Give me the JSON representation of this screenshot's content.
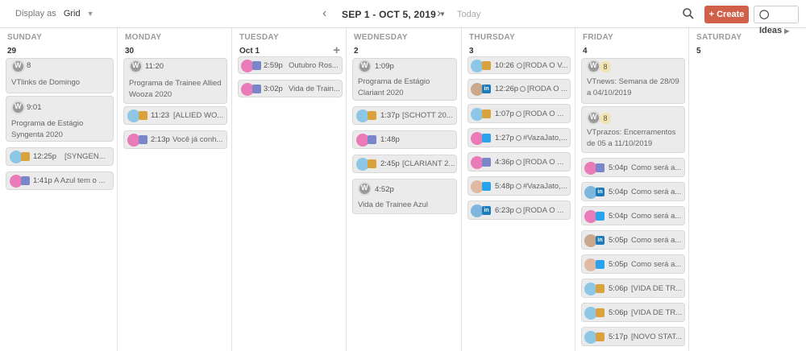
{
  "toolbar": {
    "display_label": "Display as",
    "display_value": "Grid",
    "date_range": "SEP 1 - OCT 5, 2019",
    "today_label": "Today",
    "create_label": "Create",
    "ideas_label": "Ideas"
  },
  "days": [
    {
      "name": "SUNDAY",
      "num": "29"
    },
    {
      "name": "MONDAY",
      "num": "30"
    },
    {
      "name": "TUESDAY",
      "num": "Oct 1"
    },
    {
      "name": "WEDNESDAY",
      "num": "2"
    },
    {
      "name": "THURSDAY",
      "num": "3"
    },
    {
      "name": "FRIDAY",
      "num": "4"
    },
    {
      "name": "SATURDAY",
      "num": "5"
    }
  ],
  "sunday": {
    "c1": {
      "badge": "8",
      "text": "VTlinks de Domingo"
    },
    "c2": {
      "time": "9:01",
      "text": "Programa de Estágio Syngenta 2020"
    },
    "c3": {
      "time": "12:25p",
      "text": "[SYNGEN..."
    },
    "c4": {
      "time": "1:41p",
      "text": "A Azul tem o ..."
    }
  },
  "monday": {
    "c1": {
      "time": "11:20",
      "text": "Programa de Trainee Allied Wooza 2020"
    },
    "c2": {
      "time": "11:23",
      "text": "[ALLIED WO..."
    },
    "c3": {
      "time": "2:13p",
      "text": "Você já conh..."
    }
  },
  "tuesday": {
    "c1": {
      "time": "2:59p",
      "text": "Outubro Ros..."
    },
    "c2": {
      "time": "3:02p",
      "text": "Vida de Train..."
    }
  },
  "wednesday": {
    "c1": {
      "time": "1:09p",
      "text": "Programa de Estágio Clariant 2020"
    },
    "c2": {
      "time": "1:37p",
      "text": "[SCHOTT 20..."
    },
    "c3": {
      "time": "1:48p",
      "text": ""
    },
    "c4": {
      "time": "2:45p",
      "text": "[CLARIANT 2..."
    },
    "c5": {
      "time": "4:52p",
      "text": "Vida de Trainee Azul"
    }
  },
  "thursday": {
    "c1": {
      "time": "10:26",
      "text": "[RODA O V..."
    },
    "c2": {
      "time": "12:26p",
      "text": "[RODA O ..."
    },
    "c3": {
      "time": "1:07p",
      "text": "[RODA O ..."
    },
    "c4": {
      "time": "1:27p",
      "text": "#VazaJato,..."
    },
    "c5": {
      "time": "4:36p",
      "text": "[RODA O ..."
    },
    "c6": {
      "time": "5:48p",
      "text": "#VazaJato,..."
    },
    "c7": {
      "time": "6:23p",
      "text": "[RODA O ..."
    }
  },
  "friday": {
    "c1": {
      "badge": "8",
      "text": "VTnews: Semana de 28/09 a 04/10/2019"
    },
    "c2": {
      "badge": "8",
      "text": "VTprazos: Encerramentos de 05 a 11/10/2019"
    },
    "c3": {
      "time": "5:04p",
      "text": "Como será a..."
    },
    "c4": {
      "time": "5:04p",
      "text": "Como será a..."
    },
    "c5": {
      "time": "5:04p",
      "text": "Como será a..."
    },
    "c6": {
      "time": "5:05p",
      "text": "Como será a..."
    },
    "c7": {
      "time": "5:05p",
      "text": "Como será a..."
    },
    "c8": {
      "time": "5:06p",
      "text": "[VIDA DE TR..."
    },
    "c9": {
      "time": "5:06p",
      "text": "[VIDA DE TR..."
    },
    "c10": {
      "time": "5:17p",
      "text": "[NOVO STAT..."
    }
  },
  "colors": {
    "create": "#d1604a",
    "linkedin": "#1b7bbd",
    "twitter": "#2aa3ef",
    "facebook": "#7a86c9",
    "instagram": "#d9a23d",
    "avatar_pink": "#e97bb8",
    "avatar_landscape": "#8ec6e6"
  }
}
